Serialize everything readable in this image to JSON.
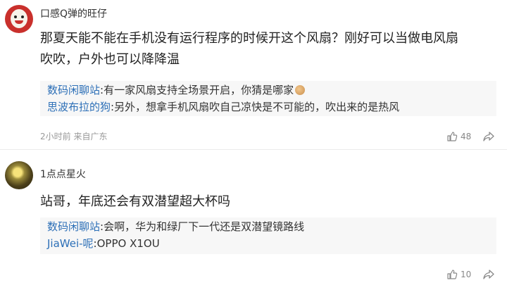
{
  "comments": [
    {
      "username": "口感Q弹的旺仔",
      "text_lines": [
        "那夏天能不能在手机没有运行程序的时候开这个风扇？刚好可以当做电风扇",
        "吹吹，户外也可以降降温"
      ],
      "replies": [
        {
          "name": "数码闲聊站",
          "text": ":有一家风扇支持全场景开启，你猜是哪家"
        },
        {
          "name": "思波布拉的狗",
          "text": ":另外，想拿手机风扇吹自己凉快是不可能的，吹出来的是热风"
        }
      ],
      "meta": "2小时前 来自广东",
      "likes": "48",
      "avatar_icon": "cartoon-face-icon"
    },
    {
      "username": "1点点星火",
      "text_lines": [
        "站哥，年底还会有双潜望超大杯吗"
      ],
      "replies": [
        {
          "name": "数码闲聊站",
          "text": ":会啊，华为和绿厂下一代还是双潜望镜路线"
        },
        {
          "name": "JiaWei-呢",
          "text": ":OPPO X1OU"
        }
      ],
      "likes": "10",
      "avatar_icon": "glowing-orb-icon"
    }
  ],
  "icons": {
    "like": "thumbs-up-icon",
    "share": "share-icon"
  },
  "colors": {
    "reply_name": "#2c6fb7",
    "reply_bg": "#f7f7f7",
    "meta": "#999999"
  }
}
